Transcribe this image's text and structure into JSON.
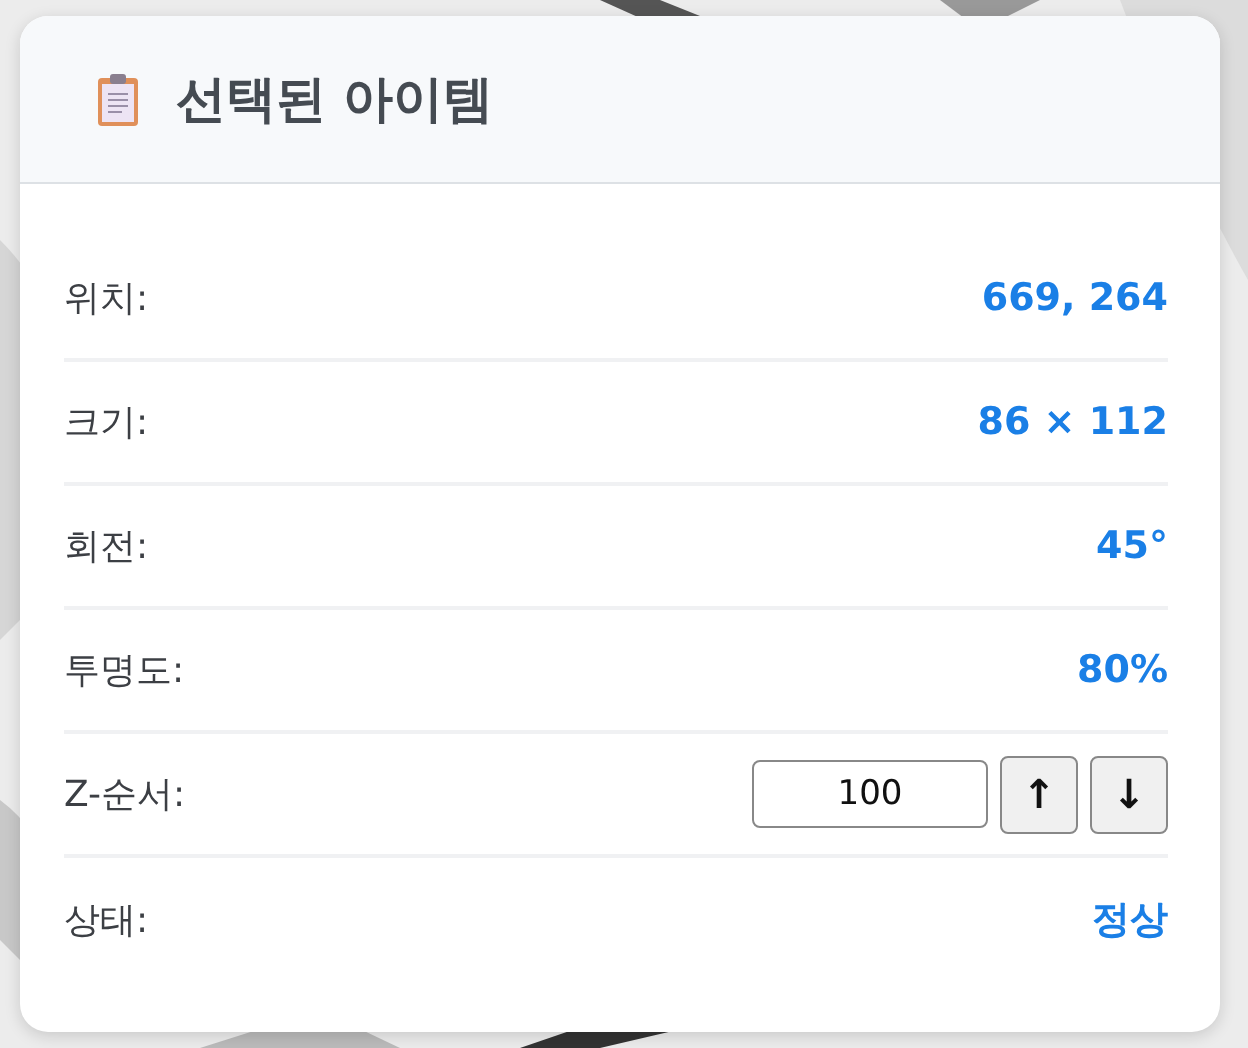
{
  "panel": {
    "title": "선택된 아이템"
  },
  "properties": [
    {
      "kind": "text",
      "label": "위치:",
      "value": "669, 264"
    },
    {
      "kind": "text",
      "label": "크기:",
      "value": "86 × 112"
    },
    {
      "kind": "text",
      "label": "회전:",
      "value": "45°"
    },
    {
      "kind": "text",
      "label": "투명도:",
      "value": "80%"
    },
    {
      "kind": "stepper",
      "label": "Z-순서:",
      "value": "100",
      "up": "↑",
      "down": "↓"
    },
    {
      "kind": "text",
      "label": "상태:",
      "value": "정상"
    }
  ]
}
